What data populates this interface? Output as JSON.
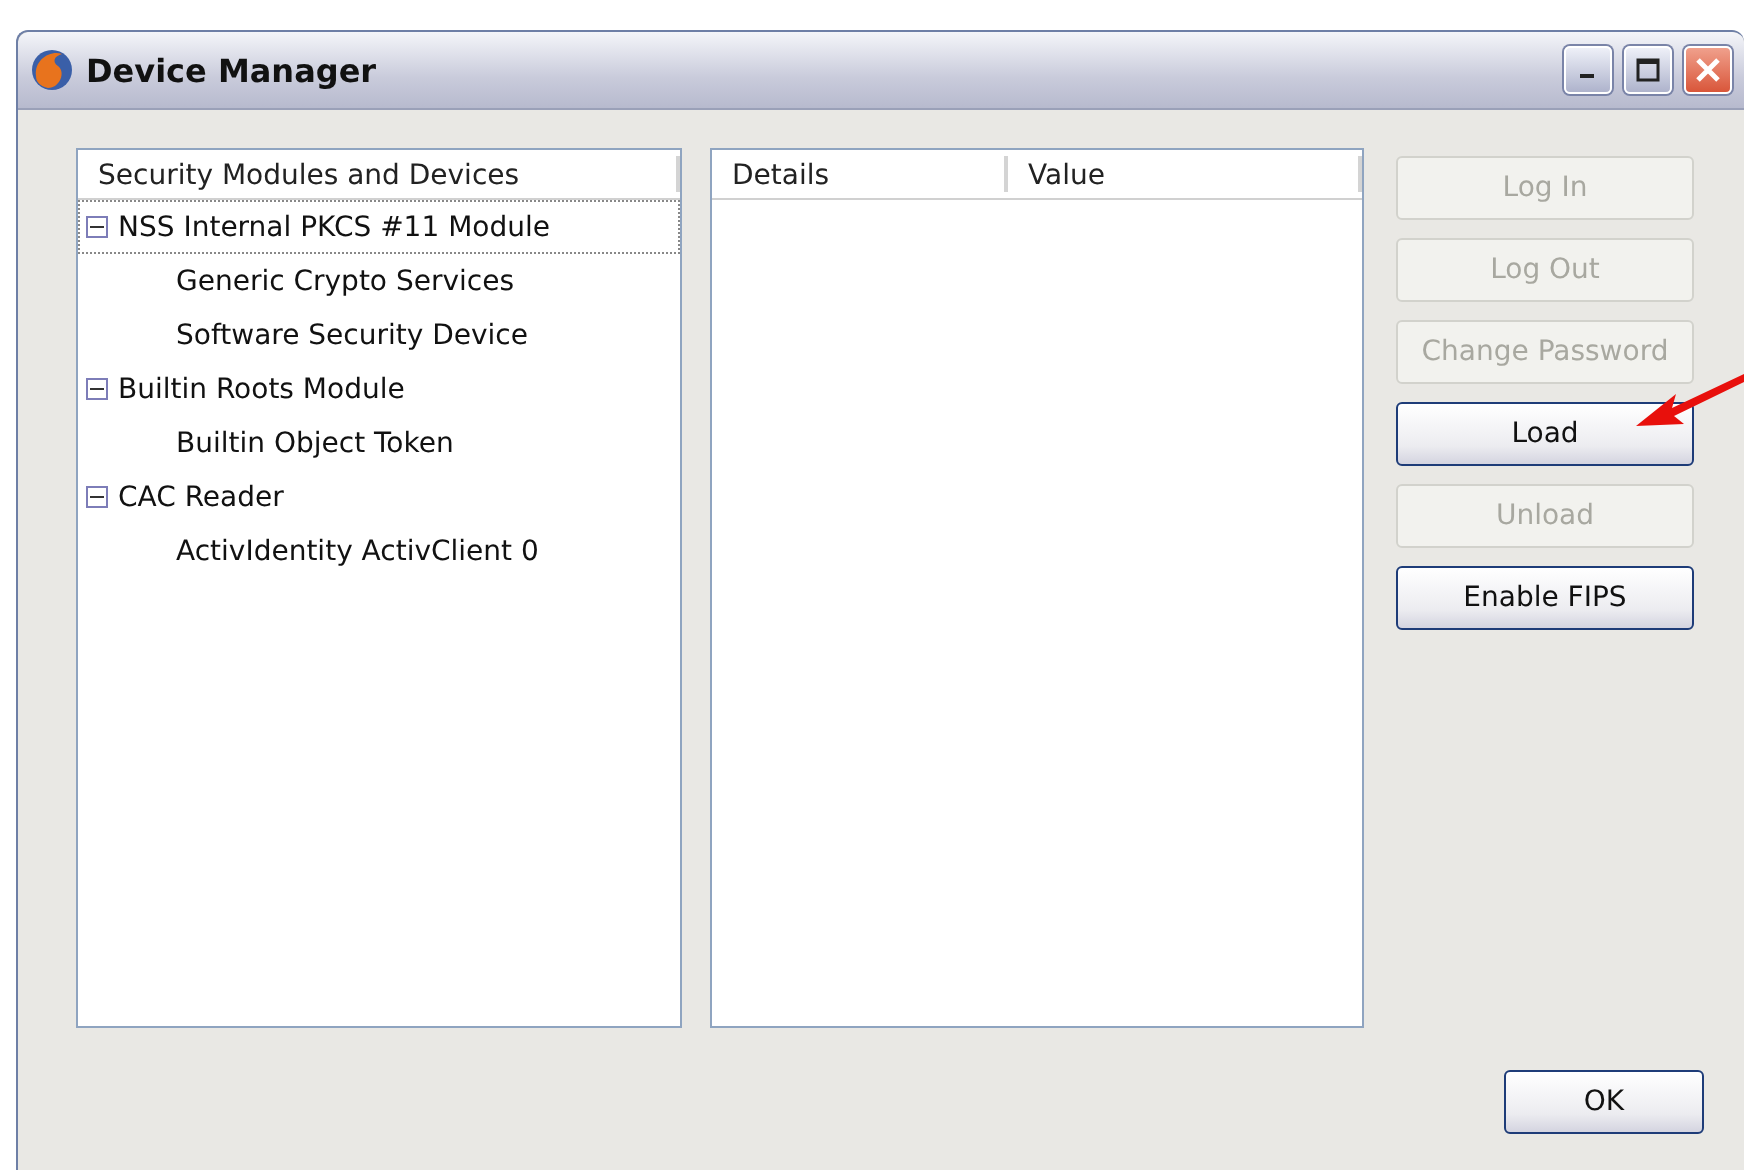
{
  "window": {
    "title": "Device Manager"
  },
  "tree": {
    "column": "Security Modules and Devices",
    "items": [
      {
        "label": "NSS Internal PKCS #11 Module",
        "expanded": true,
        "selected": true,
        "children": [
          {
            "label": "Generic Crypto Services",
            "selected": false
          },
          {
            "label": "Software Security Device",
            "selected": false
          }
        ]
      },
      {
        "label": "Builtin Roots Module",
        "expanded": true,
        "selected": false,
        "children": [
          {
            "label": "Builtin Object Token",
            "selected": false
          }
        ]
      },
      {
        "label": "CAC Reader",
        "expanded": true,
        "selected": false,
        "children": [
          {
            "label": "ActivIdentity ActivClient 0",
            "selected": false
          }
        ]
      }
    ]
  },
  "details": {
    "columns": [
      "Details",
      "Value"
    ]
  },
  "buttons": [
    {
      "label": "Log In",
      "disabled": true
    },
    {
      "label": "Log Out",
      "disabled": true
    },
    {
      "label": "Change Password",
      "disabled": true
    },
    {
      "label": "Load",
      "disabled": false
    },
    {
      "label": "Unload",
      "disabled": true
    },
    {
      "label": "Enable FIPS",
      "disabled": false
    }
  ],
  "ok_button": "OK"
}
